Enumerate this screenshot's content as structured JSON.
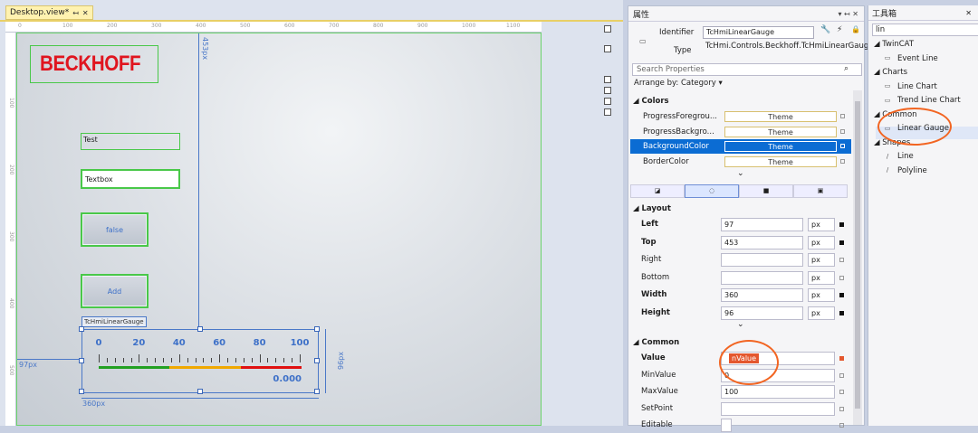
{
  "designer": {
    "tab_title": "Desktop.view*",
    "tab_pin": "↤",
    "tab_close": "✕",
    "ruler_top": [
      "0",
      "100",
      "200",
      "300",
      "400",
      "500",
      "600",
      "700",
      "800",
      "900",
      "1000",
      "1100"
    ],
    "ruler_left": [
      "100",
      "200",
      "300",
      "400",
      "500"
    ],
    "logo_text": "BECKHOFF",
    "label_test": "Test",
    "textbox_value": "Textbox",
    "button_false": "false",
    "button_add": "Add",
    "gauge_name": "TcHmiLinearGauge",
    "top_dim": "453px",
    "left_dim": "97px",
    "width_dim": "360px",
    "height_dim": "96px",
    "gauge": {
      "labels": [
        "0",
        "20",
        "40",
        "60",
        "80",
        "100"
      ],
      "value_text": "0.000",
      "segments": [
        {
          "color": "#22a022",
          "fraction": 0.35
        },
        {
          "color": "#f0a800",
          "fraction": 0.35
        },
        {
          "color": "#e01010",
          "fraction": 0.3
        }
      ]
    }
  },
  "properties": {
    "title": "属性",
    "title_buttons": "▾ ↤ ✕",
    "identifier_label": "Identifier",
    "identifier_value": "TcHmiLinearGauge",
    "type_label": "Type",
    "type_value": "TcHmi.Controls.Beckhoff.TcHmiLinearGauge",
    "search_placeholder": "Search Properties",
    "arrange_by": "Arrange by: Category ▾",
    "colors_section": "Colors",
    "colors": [
      {
        "name": "ProgressForegrou...",
        "value": "Theme"
      },
      {
        "name": "ProgressBackgro...",
        "value": "Theme"
      },
      {
        "name": "BackgroundColor",
        "value": "Theme"
      },
      {
        "name": "BorderColor",
        "value": "Theme"
      }
    ],
    "layout_section": "Layout",
    "layout": [
      {
        "name": "Left",
        "value": "97",
        "unit": "px"
      },
      {
        "name": "Top",
        "value": "453",
        "unit": "px"
      },
      {
        "name": "Right",
        "value": "",
        "unit": "px"
      },
      {
        "name": "Bottom",
        "value": "",
        "unit": "px"
      },
      {
        "name": "Width",
        "value": "360",
        "unit": "px"
      },
      {
        "name": "Height",
        "value": "96",
        "unit": "px"
      }
    ],
    "common_section": "Common",
    "common": [
      {
        "name": "Value",
        "value": "nValue"
      },
      {
        "name": "MinValue",
        "value": "0"
      },
      {
        "name": "MaxValue",
        "value": "100"
      },
      {
        "name": "SetPoint",
        "value": ""
      },
      {
        "name": "Editable",
        "value": ""
      }
    ]
  },
  "toolbox": {
    "title": "工具箱",
    "search_value": "lin",
    "groups": [
      {
        "name": "TwinCAT",
        "items": [
          "Event Line"
        ]
      },
      {
        "name": "Charts",
        "items": [
          "Line Chart",
          "Trend Line Chart"
        ]
      },
      {
        "name": "Common",
        "items": [
          "Linear Gauge"
        ]
      },
      {
        "name": "Shapes",
        "items": [
          "Line",
          "Polyline"
        ]
      }
    ]
  }
}
